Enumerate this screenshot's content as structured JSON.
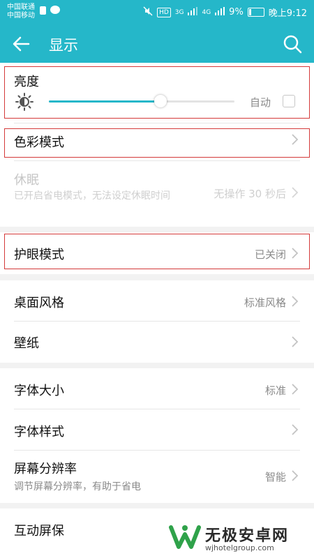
{
  "status_bar": {
    "carrier_1": "中国联通",
    "carrier_2": "中国移动",
    "hd": "HD",
    "signal_1": "3G",
    "signal_2": "4G",
    "battery_percent": "9%",
    "time": "晚上9:12"
  },
  "appbar": {
    "title": "显示"
  },
  "brightness": {
    "label": "亮度",
    "level": 0.6,
    "auto_label": "自动",
    "auto_checked": false
  },
  "color_mode": {
    "label": "色彩模式"
  },
  "sleep": {
    "label": "休眠",
    "desc": "已开启省电模式，无法设定休眠时间",
    "value": "无操作 30 秒后"
  },
  "eye_comfort": {
    "label": "护眼模式",
    "value": "已关闭"
  },
  "desktop_style": {
    "label": "桌面风格",
    "value": "标准风格"
  },
  "wallpaper": {
    "label": "壁纸"
  },
  "font_size": {
    "label": "字体大小",
    "value": "标准"
  },
  "font_style": {
    "label": "字体样式"
  },
  "resolution": {
    "label": "屏幕分辨率",
    "desc": "调节屏幕分辨率，有助于省电",
    "value": "智能"
  },
  "screensaver": {
    "label": "互动屏保"
  },
  "watermark": {
    "title": "无极安卓网",
    "url": "wjhotelgroup.com"
  },
  "colors": {
    "accent": "#25b7c9",
    "highlight": "#d43a3a"
  }
}
